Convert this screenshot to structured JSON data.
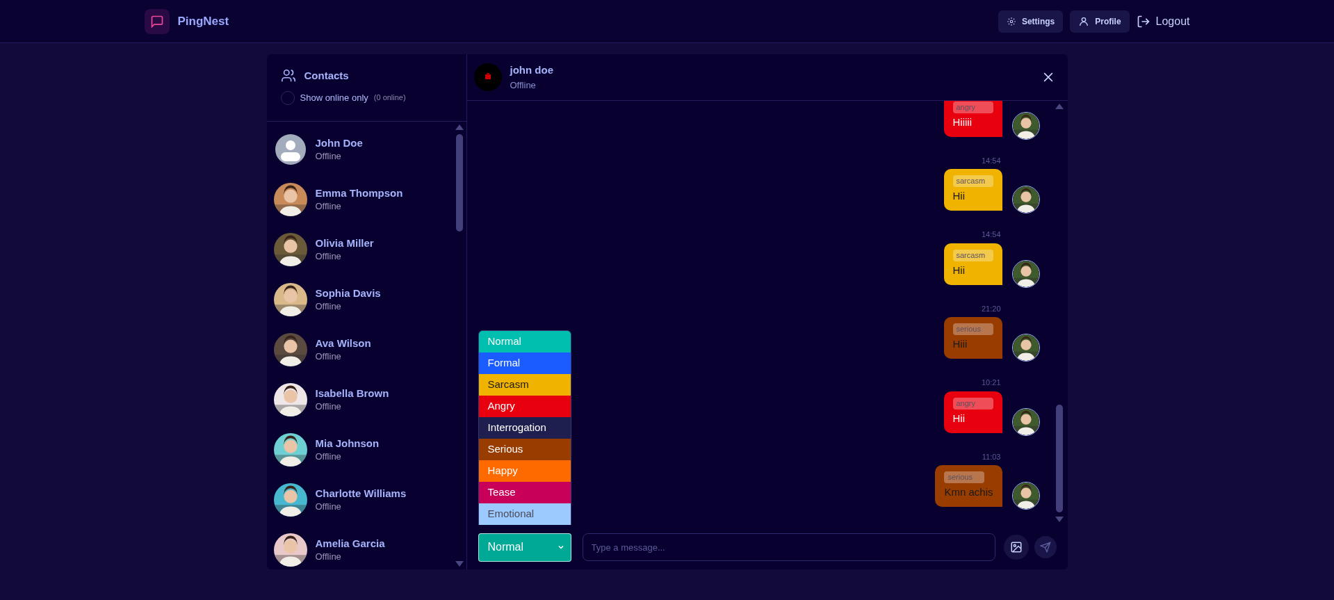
{
  "header": {
    "app_name": "PingNest",
    "buttons": [
      {
        "label": "Settings",
        "kind": "pill"
      },
      {
        "label": "Profile",
        "kind": "pill"
      },
      {
        "label": "Logout",
        "kind": "plain"
      }
    ]
  },
  "contacts": {
    "title": "Contacts",
    "filter": {
      "label": "Show online only",
      "count": "(0 online)",
      "checked": false
    },
    "items": [
      {
        "name": "John Doe",
        "status": "Offline",
        "kind": "default"
      },
      {
        "name": "Emma Thompson",
        "status": "Offline",
        "kind": "picture"
      },
      {
        "name": "Olivia Miller",
        "status": "Offline",
        "kind": "picture"
      },
      {
        "name": "Sophia Davis",
        "status": "Offline",
        "kind": "picture"
      },
      {
        "name": "Ava Wilson",
        "status": "Offline",
        "kind": "picture"
      },
      {
        "name": "Isabella Brown",
        "status": "Offline",
        "kind": "picture"
      },
      {
        "name": "Mia Johnson",
        "status": "Offline",
        "kind": "picture"
      },
      {
        "name": "Charlotte Williams",
        "status": "Offline",
        "kind": "picture"
      },
      {
        "name": "Amelia Garcia",
        "status": "Offline",
        "kind": "picture"
      }
    ]
  },
  "chat": {
    "name": "john doe",
    "status": "Offline",
    "messages": [
      {
        "mood": "angry",
        "text": "Hiiiii",
        "color": "#e8000f"
      },
      {
        "time": "14:54",
        "mood": "sarcasm",
        "text": "Hii",
        "color": "#f0b400"
      },
      {
        "time": "14:54",
        "mood": "sarcasm",
        "text": "Hii",
        "color": "#f0b400"
      },
      {
        "time": "21:20",
        "mood": "serious",
        "text": "Hiii",
        "color": "#983c00"
      },
      {
        "time": "10:21",
        "mood": "angry",
        "text": "Hii",
        "color": "#e8000f"
      },
      {
        "time": "11:03",
        "mood": "serious",
        "text": "Kmn achis",
        "color": "#983c00"
      }
    ],
    "mood_options": [
      {
        "label": "Normal",
        "color": "#00bfae"
      },
      {
        "label": "Formal",
        "color": "#1a5cff"
      },
      {
        "label": "Sarcasm",
        "color": "#f0b400"
      },
      {
        "label": "Angry",
        "color": "#e8000f"
      },
      {
        "label": "Interrogation",
        "color": "#1f1f4f"
      },
      {
        "label": "Serious",
        "color": "#983c00"
      },
      {
        "label": "Happy",
        "color": "#ff6a00"
      },
      {
        "label": "Tease",
        "color": "#c8005a"
      },
      {
        "label": "Emotional",
        "color": "#9ccaff"
      }
    ],
    "mood_select": {
      "value": "Normal",
      "color": "#00a896",
      "expanded": true
    },
    "input": {
      "placeholder": "Type a message..."
    }
  }
}
